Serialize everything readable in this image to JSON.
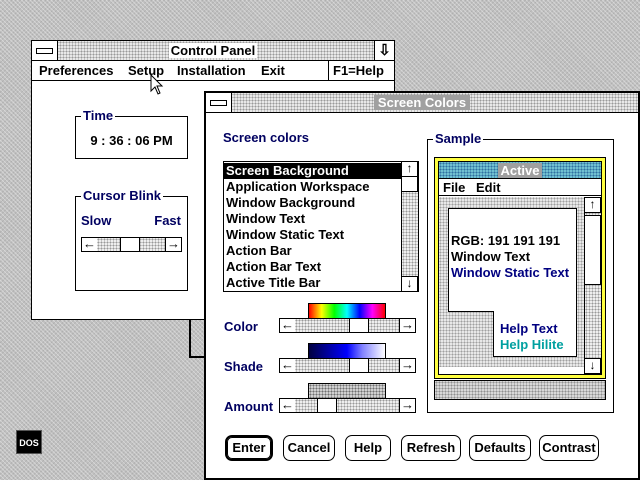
{
  "control_panel": {
    "title": "Control Panel",
    "menu": {
      "preferences": "Preferences",
      "setup": "Setup",
      "installation": "Installation",
      "exit": "Exit",
      "help": "F1=Help"
    },
    "time": {
      "label": "Time",
      "value": "9 : 36 : 06 PM"
    },
    "cursor_blink": {
      "label": "Cursor Blink",
      "slow": "Slow",
      "fast": "Fast"
    }
  },
  "screen_colors": {
    "title": "Screen Colors",
    "list_label": "Screen colors",
    "sample_label": "Sample",
    "items": [
      "Screen Background",
      "Application Workspace",
      "Window Background",
      "Window Text",
      "Window Static Text",
      "Action Bar",
      "Action Bar Text",
      "Active Title Bar"
    ],
    "selected_index": 0,
    "color_label": "Color",
    "shade_label": "Shade",
    "amount_label": "Amount",
    "buttons": {
      "enter": "Enter",
      "cancel": "Cancel",
      "help": "Help",
      "refresh": "Refresh",
      "defaults": "Defaults",
      "contrast": "Contrast"
    },
    "sample": {
      "title": "Active",
      "menu_file": "File",
      "menu_edit": "Edit",
      "rgb": "RGB: 191 191 191",
      "window_text": "Window Text",
      "window_static_text": "Window Static Text",
      "help_text": "Help Text",
      "help_hilite": "Help Hilite"
    }
  },
  "desktop": {
    "dos_icon_label": "DOS"
  },
  "colors": {
    "label_navy": "#000060",
    "sample_border": "#ffff40",
    "sample_title": "#0000a0",
    "help_hilite": "#00a0a0",
    "static_text": "#000080"
  },
  "icons": {
    "left_arrow": "←",
    "right_arrow": "→",
    "up_arrow": "↑",
    "down_arrow": "↓",
    "minimize": "⇩"
  }
}
